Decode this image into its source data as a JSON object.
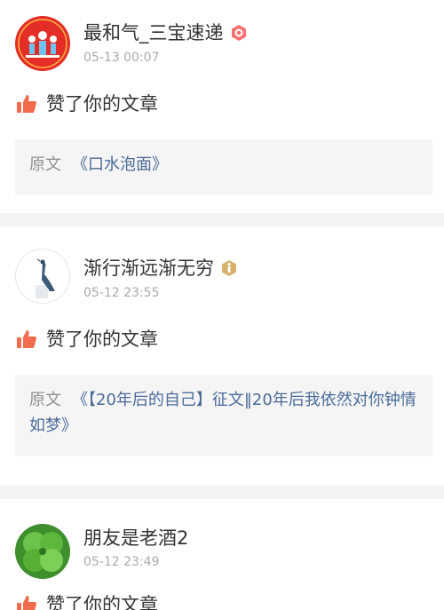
{
  "feed": {
    "items": [
      {
        "username": "最和气_三宝速递",
        "time": "05-13 00:07",
        "action": "赞了你的文章",
        "ref_prefix": "原文",
        "ref_title": "《口水泡面》",
        "badge": "orange-hexagon-badge-icon"
      },
      {
        "username": "渐行渐远渐无穷",
        "time": "05-12 23:55",
        "action": "赞了你的文章",
        "ref_prefix": "原文",
        "ref_title": "《【20年后的自己】征文‖20年后我依然对你钟情如梦》",
        "badge": "gold-hexagon-badge-icon"
      },
      {
        "username": "朋友是老酒2",
        "time": "05-12 23:49",
        "action": "赞了你的文章"
      }
    ]
  },
  "colors": {
    "thumb": "#f26b4d",
    "link": "#4a6b9a",
    "separator": "#f3f3f3",
    "ref_bg": "#f5f5f5"
  }
}
